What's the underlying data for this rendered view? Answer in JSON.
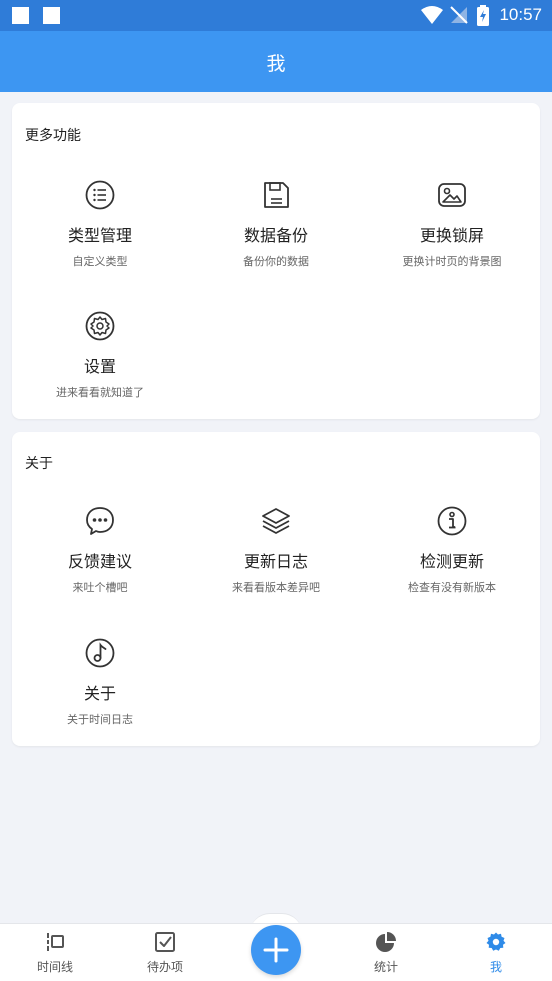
{
  "status_bar": {
    "time": "10:57"
  },
  "header": {
    "title": "我"
  },
  "more_features": {
    "title": "更多功能",
    "items": [
      {
        "label": "类型管理",
        "desc": "自定义类型",
        "icon": "list-icon"
      },
      {
        "label": "数据备份",
        "desc": "备份你的数据",
        "icon": "save-icon"
      },
      {
        "label": "更换锁屏",
        "desc": "更换计时页的背景图",
        "icon": "image-icon"
      },
      {
        "label": "设置",
        "desc": "进来看看就知道了",
        "icon": "gear-icon"
      }
    ]
  },
  "about": {
    "title": "关于",
    "items": [
      {
        "label": "反馈建议",
        "desc": "来吐个槽吧",
        "icon": "chat-bubble-icon"
      },
      {
        "label": "更新日志",
        "desc": "来看看版本差异吧",
        "icon": "layers-icon"
      },
      {
        "label": "检测更新",
        "desc": "检查有没有新版本",
        "icon": "info-icon"
      },
      {
        "label": "关于",
        "desc": "关于时间日志",
        "icon": "music-note-icon"
      }
    ]
  },
  "bottom_nav": {
    "items": [
      {
        "label": "时间线",
        "icon": "timeline-icon",
        "active": false
      },
      {
        "label": "待办项",
        "icon": "checkbox-icon",
        "active": false
      },
      {
        "label": "统计",
        "icon": "pie-chart-icon",
        "active": false
      },
      {
        "label": "我",
        "icon": "gear-icon",
        "active": true
      }
    ],
    "fab_icon": "plus-icon"
  },
  "colors": {
    "accent": "#3d96f2",
    "status_bar": "#2f7cd8",
    "active_nav": "#2f8be8"
  }
}
